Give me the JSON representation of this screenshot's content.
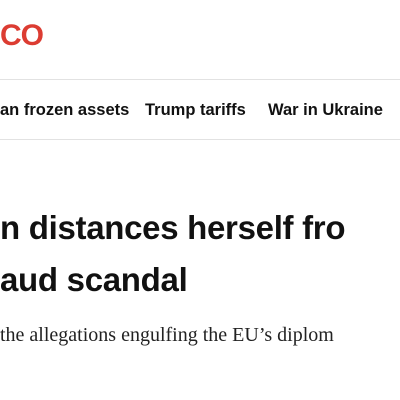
{
  "brand": {
    "logo_text": "CO",
    "accent_color": "#dc3c32"
  },
  "nav": {
    "items": [
      {
        "label": "an frozen assets"
      },
      {
        "label": "Trump tariffs"
      },
      {
        "label": "War in Ukraine"
      }
    ]
  },
  "article": {
    "headline_lines": [
      "n distances herself fro",
      "aud scandal"
    ],
    "subhead": "the allegations engulfing the EU’s diplom"
  }
}
